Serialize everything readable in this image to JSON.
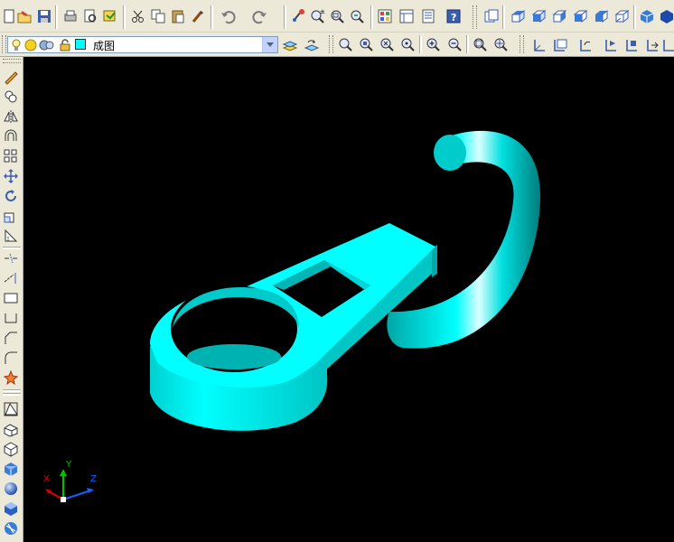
{
  "app": {
    "title": ""
  },
  "layer_toolbar": {
    "current_layer": "成图",
    "layer_color": "#00ffff"
  },
  "toolbar_top_icons": [
    "new-icon",
    "open-icon",
    "save-icon",
    "print-icon",
    "print-preview-icon",
    "publish-icon",
    "cut-icon",
    "copy-icon",
    "paste-icon",
    "match-properties-icon",
    "undo-icon",
    "redo-icon",
    "pan-icon",
    "zoom-realtime-icon",
    "zoom-window-icon",
    "zoom-previous-icon",
    "properties-icon",
    "design-center-icon",
    "tool-palettes-icon",
    "help-icon",
    "views-icon",
    "top-view-icon",
    "bottom-view-icon",
    "left-view-icon",
    "right-view-icon",
    "front-view-icon",
    "back-view-icon",
    "shade-icon"
  ],
  "toolbar_second_icons": [
    "layer-manager-icon",
    "layer-previous-icon",
    "zoom-window-icon",
    "zoom-dynamic-icon",
    "zoom-scale-icon",
    "zoom-center-icon",
    "zoom-in-icon",
    "zoom-out-icon",
    "zoom-all-icon",
    "zoom-extents-icon",
    "ucs-icon",
    "ucs-world-icon",
    "ucs-previous-icon",
    "ucs-face-icon",
    "ucs-object-icon",
    "ucs-view-icon",
    "ucs-origin-icon"
  ],
  "left_toolbar_icons": [
    "erase-icon",
    "copy-object-icon",
    "mirror-icon",
    "offset-icon",
    "array-icon",
    "move-icon",
    "rotate-icon",
    "scale-icon",
    "stretch-icon",
    "trim-icon",
    "extend-icon",
    "break-icon",
    "chamfer-icon",
    "fillet-icon",
    "explode-icon",
    "box-solid-icon",
    "wedge-icon",
    "cube-icon",
    "shaded-box-icon",
    "sphere-icon",
    "cylinder-icon",
    "torus-icon"
  ],
  "ucs": {
    "x_label": "X",
    "y_label": "Y",
    "z_label": "Z"
  },
  "colors": {
    "viewport_bg": "#000000",
    "model": "#00e5e5",
    "x_axis": "#e00000",
    "y_axis": "#00c000",
    "z_axis": "#1060ff"
  }
}
